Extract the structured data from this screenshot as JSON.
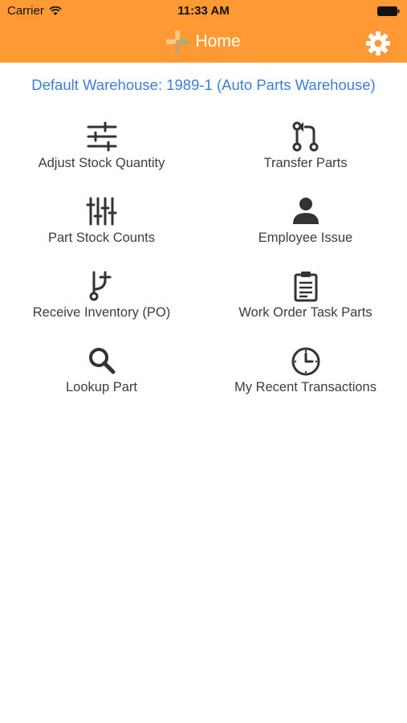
{
  "status": {
    "carrier": "Carrier",
    "time": "11:33 AM"
  },
  "nav": {
    "title": "Home"
  },
  "warehouse": {
    "label": "Default Warehouse: 1989-1 (Auto Parts Warehouse)"
  },
  "menu": [
    {
      "label": "Adjust Stock Quantity",
      "icon": "sliders-icon"
    },
    {
      "label": "Transfer Parts",
      "icon": "transfer-icon"
    },
    {
      "label": "Part Stock Counts",
      "icon": "vertical-sliders-icon"
    },
    {
      "label": "Employee Issue",
      "icon": "user-icon"
    },
    {
      "label": "Receive Inventory (PO)",
      "icon": "branch-plus-icon"
    },
    {
      "label": "Work Order Task Parts",
      "icon": "clipboard-icon"
    },
    {
      "label": "Lookup Part",
      "icon": "search-icon"
    },
    {
      "label": "My Recent Transactions",
      "icon": "clock-icon"
    }
  ],
  "colors": {
    "header": "#ff9933",
    "link": "#3b7fd6",
    "icon": "#333333"
  }
}
